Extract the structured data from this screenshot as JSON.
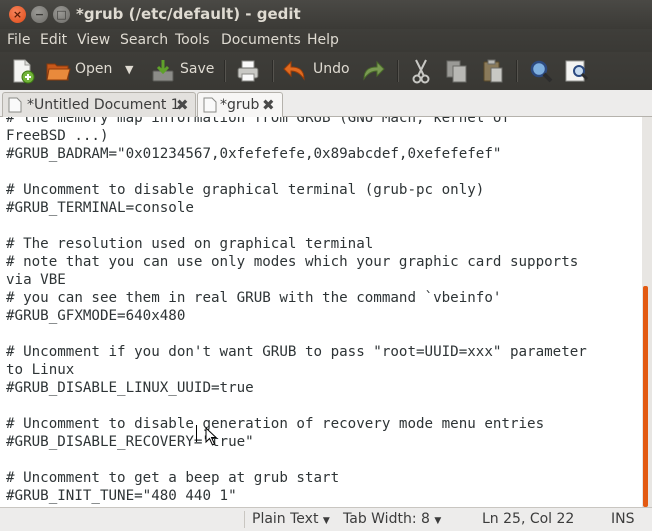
{
  "window": {
    "title": "*grub (/etc/default) - gedit",
    "close": "×",
    "minimize": "−",
    "maximize": "□"
  },
  "menu": [
    "File",
    "Edit",
    "View",
    "Search",
    "Tools",
    "Documents",
    "Help"
  ],
  "toolbar": {
    "open_label": "Open",
    "save_label": "Save",
    "undo_label": "Undo"
  },
  "tabs": [
    {
      "label": "*Untitled Document 1",
      "close": "✖"
    },
    {
      "label": "*grub",
      "close": "✖"
    }
  ],
  "editor": {
    "lines": [
      "# the memory map information from GRUB (GNU Mach, kernel of",
      "FreeBSD ...)",
      "#GRUB_BADRAM=\"0x01234567,0xfefefefe,0x89abcdef,0xefefefef\"",
      "",
      "# Uncomment to disable graphical terminal (grub-pc only)",
      "#GRUB_TERMINAL=console",
      "",
      "# The resolution used on graphical terminal",
      "# note that you can use only modes which your graphic card supports",
      "via VBE",
      "# you can see them in real GRUB with the command `vbeinfo'",
      "#GRUB_GFXMODE=640x480",
      "",
      "# Uncomment if you don't want GRUB to pass \"root=UUID=xxx\" parameter",
      "to Linux",
      "#GRUB_DISABLE_LINUX_UUID=true",
      "",
      "# Uncomment to disable generation of recovery mode menu entries",
      "#GRUB_DISABLE_RECOVERY=\"true\"",
      "",
      "# Uncomment to get a beep at grub start",
      "#GRUB_INIT_TUNE=\"480 440 1\""
    ]
  },
  "statusbar": {
    "language": "Plain Text",
    "tab_width": "Tab Width: 8",
    "position": "Ln 25, Col 22",
    "mode": "INS",
    "dropdown": "▼"
  },
  "colors": {
    "titlebar": "#3c3b37",
    "accent": "#e35a12",
    "editor_bg": "#ffffff"
  }
}
